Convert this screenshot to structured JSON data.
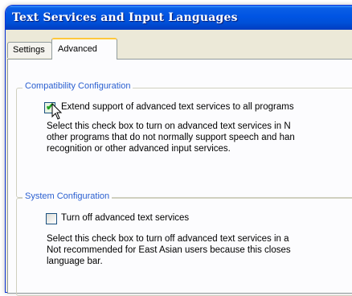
{
  "window": {
    "title": "Text Services and Input Languages"
  },
  "tabs": [
    {
      "label": "Settings",
      "selected": false
    },
    {
      "label": "Advanced",
      "selected": true
    }
  ],
  "compatibility": {
    "legend": "Compatibility Configuration",
    "checkbox_label": "Extend support of advanced text services to all programs",
    "checked": true,
    "description_lines": [
      "Select this check box to turn on advanced text services in N",
      "other programs that do not normally support speech and han",
      "recognition or other advanced input services."
    ]
  },
  "system": {
    "legend": "System Configuration",
    "checkbox_label": "Turn off advanced text services",
    "checked": false,
    "description_lines": [
      "Select this check box to turn off advanced text services in a",
      "Not recommended for East Asian users because this closes",
      "language bar."
    ]
  },
  "colors": {
    "titlebar": "#0054e3",
    "dialog_bg": "#ece9d8",
    "group_legend": "#2a5fd0",
    "tab_highlight": "#ffc83c"
  }
}
